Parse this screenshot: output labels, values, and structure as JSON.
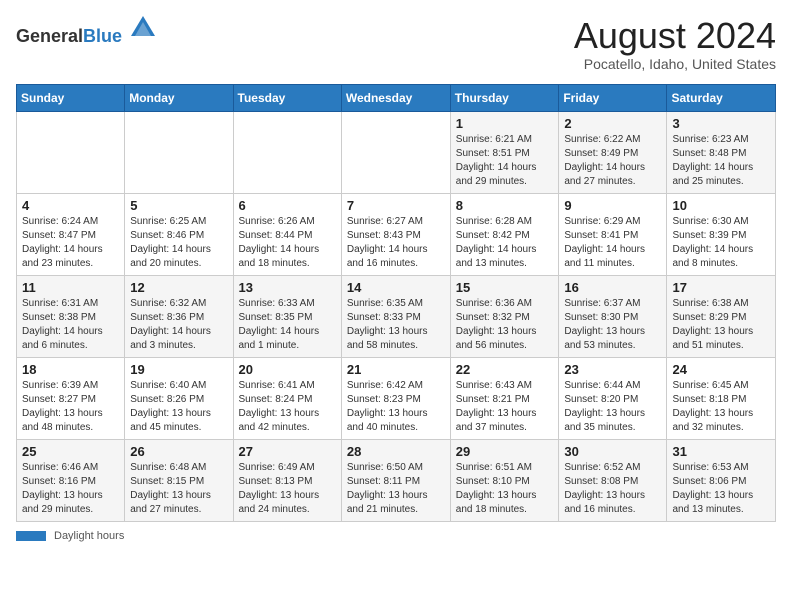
{
  "header": {
    "logo_general": "General",
    "logo_blue": "Blue",
    "month_title": "August 2024",
    "location": "Pocatello, Idaho, United States"
  },
  "days_of_week": [
    "Sunday",
    "Monday",
    "Tuesday",
    "Wednesday",
    "Thursday",
    "Friday",
    "Saturday"
  ],
  "weeks": [
    [
      {
        "day": "",
        "sunrise": "",
        "sunset": "",
        "daylight": ""
      },
      {
        "day": "",
        "sunrise": "",
        "sunset": "",
        "daylight": ""
      },
      {
        "day": "",
        "sunrise": "",
        "sunset": "",
        "daylight": ""
      },
      {
        "day": "",
        "sunrise": "",
        "sunset": "",
        "daylight": ""
      },
      {
        "day": "1",
        "sunrise": "6:21 AM",
        "sunset": "8:51 PM",
        "daylight": "14 hours and 29 minutes."
      },
      {
        "day": "2",
        "sunrise": "6:22 AM",
        "sunset": "8:49 PM",
        "daylight": "14 hours and 27 minutes."
      },
      {
        "day": "3",
        "sunrise": "6:23 AM",
        "sunset": "8:48 PM",
        "daylight": "14 hours and 25 minutes."
      }
    ],
    [
      {
        "day": "4",
        "sunrise": "6:24 AM",
        "sunset": "8:47 PM",
        "daylight": "14 hours and 23 minutes."
      },
      {
        "day": "5",
        "sunrise": "6:25 AM",
        "sunset": "8:46 PM",
        "daylight": "14 hours and 20 minutes."
      },
      {
        "day": "6",
        "sunrise": "6:26 AM",
        "sunset": "8:44 PM",
        "daylight": "14 hours and 18 minutes."
      },
      {
        "day": "7",
        "sunrise": "6:27 AM",
        "sunset": "8:43 PM",
        "daylight": "14 hours and 16 minutes."
      },
      {
        "day": "8",
        "sunrise": "6:28 AM",
        "sunset": "8:42 PM",
        "daylight": "14 hours and 13 minutes."
      },
      {
        "day": "9",
        "sunrise": "6:29 AM",
        "sunset": "8:41 PM",
        "daylight": "14 hours and 11 minutes."
      },
      {
        "day": "10",
        "sunrise": "6:30 AM",
        "sunset": "8:39 PM",
        "daylight": "14 hours and 8 minutes."
      }
    ],
    [
      {
        "day": "11",
        "sunrise": "6:31 AM",
        "sunset": "8:38 PM",
        "daylight": "14 hours and 6 minutes."
      },
      {
        "day": "12",
        "sunrise": "6:32 AM",
        "sunset": "8:36 PM",
        "daylight": "14 hours and 3 minutes."
      },
      {
        "day": "13",
        "sunrise": "6:33 AM",
        "sunset": "8:35 PM",
        "daylight": "14 hours and 1 minute."
      },
      {
        "day": "14",
        "sunrise": "6:35 AM",
        "sunset": "8:33 PM",
        "daylight": "13 hours and 58 minutes."
      },
      {
        "day": "15",
        "sunrise": "6:36 AM",
        "sunset": "8:32 PM",
        "daylight": "13 hours and 56 minutes."
      },
      {
        "day": "16",
        "sunrise": "6:37 AM",
        "sunset": "8:30 PM",
        "daylight": "13 hours and 53 minutes."
      },
      {
        "day": "17",
        "sunrise": "6:38 AM",
        "sunset": "8:29 PM",
        "daylight": "13 hours and 51 minutes."
      }
    ],
    [
      {
        "day": "18",
        "sunrise": "6:39 AM",
        "sunset": "8:27 PM",
        "daylight": "13 hours and 48 minutes."
      },
      {
        "day": "19",
        "sunrise": "6:40 AM",
        "sunset": "8:26 PM",
        "daylight": "13 hours and 45 minutes."
      },
      {
        "day": "20",
        "sunrise": "6:41 AM",
        "sunset": "8:24 PM",
        "daylight": "13 hours and 42 minutes."
      },
      {
        "day": "21",
        "sunrise": "6:42 AM",
        "sunset": "8:23 PM",
        "daylight": "13 hours and 40 minutes."
      },
      {
        "day": "22",
        "sunrise": "6:43 AM",
        "sunset": "8:21 PM",
        "daylight": "13 hours and 37 minutes."
      },
      {
        "day": "23",
        "sunrise": "6:44 AM",
        "sunset": "8:20 PM",
        "daylight": "13 hours and 35 minutes."
      },
      {
        "day": "24",
        "sunrise": "6:45 AM",
        "sunset": "8:18 PM",
        "daylight": "13 hours and 32 minutes."
      }
    ],
    [
      {
        "day": "25",
        "sunrise": "6:46 AM",
        "sunset": "8:16 PM",
        "daylight": "13 hours and 29 minutes."
      },
      {
        "day": "26",
        "sunrise": "6:48 AM",
        "sunset": "8:15 PM",
        "daylight": "13 hours and 27 minutes."
      },
      {
        "day": "27",
        "sunrise": "6:49 AM",
        "sunset": "8:13 PM",
        "daylight": "13 hours and 24 minutes."
      },
      {
        "day": "28",
        "sunrise": "6:50 AM",
        "sunset": "8:11 PM",
        "daylight": "13 hours and 21 minutes."
      },
      {
        "day": "29",
        "sunrise": "6:51 AM",
        "sunset": "8:10 PM",
        "daylight": "13 hours and 18 minutes."
      },
      {
        "day": "30",
        "sunrise": "6:52 AM",
        "sunset": "8:08 PM",
        "daylight": "13 hours and 16 minutes."
      },
      {
        "day": "31",
        "sunrise": "6:53 AM",
        "sunset": "8:06 PM",
        "daylight": "13 hours and 13 minutes."
      }
    ]
  ],
  "footer": {
    "bar_label": "Daylight hours"
  }
}
